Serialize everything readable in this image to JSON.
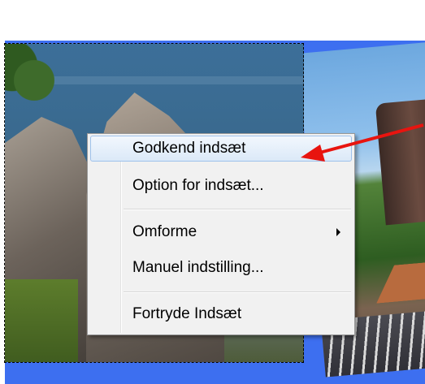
{
  "menu": {
    "items": [
      {
        "label": "Godkend indsæt",
        "highlighted": true
      },
      {
        "label": "Option for indsæt..."
      },
      {
        "label": "Omforme",
        "has_submenu": true
      },
      {
        "label": "Manuel indstilling..."
      },
      {
        "label": "Fortryde Indsæt"
      }
    ]
  },
  "annotation": {
    "color": "#e8140f"
  },
  "colors": {
    "background_band": "#3d6ff0",
    "menu_highlight": "#dbe9f8"
  }
}
